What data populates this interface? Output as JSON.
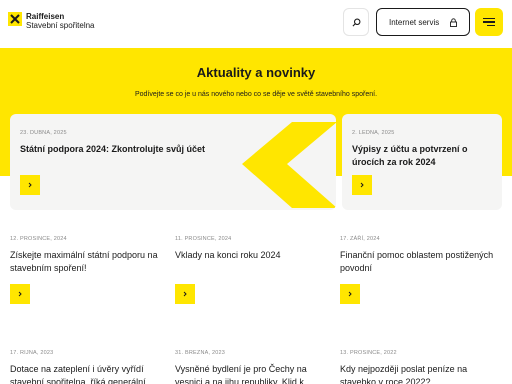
{
  "header": {
    "logo_line1": "Raiffeisen",
    "logo_line2": "Stavební spořitelna",
    "search_icon": "search-icon",
    "internet_label": "Internet servis",
    "lock_icon": "lock-icon",
    "menu_icon": "hamburger-menu-icon"
  },
  "hero": {
    "title": "Aktuality a novinky",
    "subtitle": "Podívejte se co je u nás nového nebo co se děje ve světě stavebního spoření."
  },
  "featured": [
    {
      "date": "23. DUBNA, 2025",
      "title": "Státní podpora 2024: Zkontrolujte svůj účet"
    },
    {
      "date": "2. LEDNA, 2025",
      "title": "Výpisy z účtu a potvrzení o úrocích za rok 2024"
    }
  ],
  "news": [
    {
      "date": "12. PROSINCE, 2024",
      "title": "Získejte maximální státní podporu na stavebním spoření!"
    },
    {
      "date": "11. PROSINCE, 2024",
      "title": "Vklady na konci roku 2024"
    },
    {
      "date": "17. ZÁŘÍ, 2024",
      "title": "Finanční pomoc oblastem postižených povodní"
    },
    {
      "date": "17. ŘÍJNA, 2023",
      "title": "Dotace na zateplení i úvěry vyřídí stavební spořitelna, říká generální"
    },
    {
      "date": "31. BŘEZNA, 2023",
      "title": "Vysněné bydlení je pro Čechy na vesnici a na jihu republiky. Klid k"
    },
    {
      "date": "13. PROSINCE, 2022",
      "title": "Kdy nejpozději poslat peníze na stavebko v roce 2022?"
    }
  ],
  "colors": {
    "brand_yellow": "#ffe600",
    "card_bg": "#f5f5f4",
    "text": "#1a1a1a",
    "muted": "#8a8a8a"
  },
  "arrow_icon": "chevron-right-icon"
}
